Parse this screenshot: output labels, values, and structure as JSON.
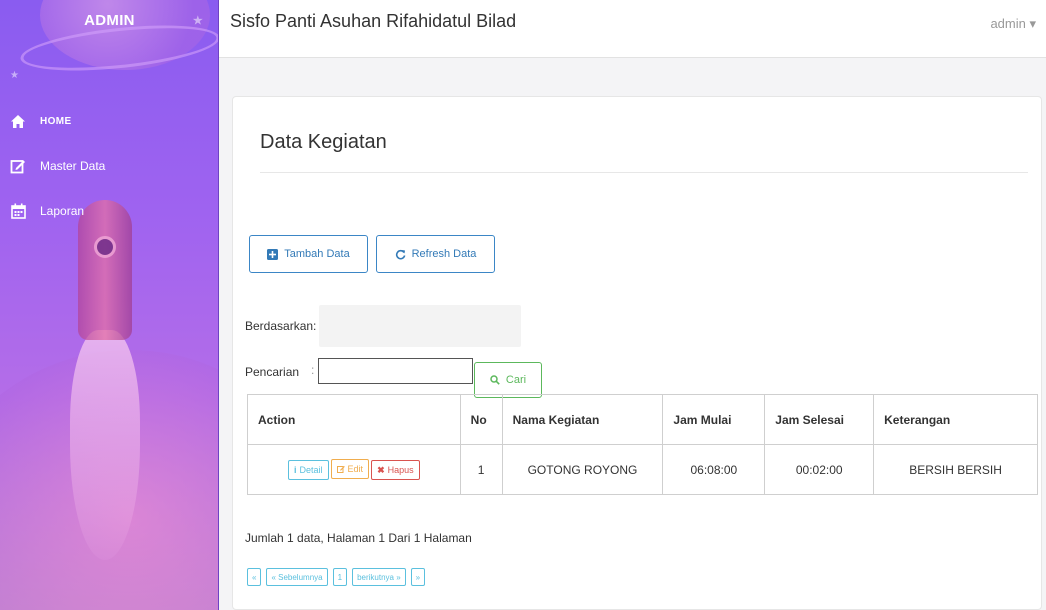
{
  "sidebar": {
    "brand": "ADMIN",
    "items": [
      {
        "label": "HOME",
        "icon": "home-icon"
      },
      {
        "label": "Master Data",
        "icon": "edit-icon"
      },
      {
        "label": "Laporan",
        "icon": "calendar-icon"
      }
    ]
  },
  "header": {
    "title": "Sisfo Panti Asuhan Rifahidatul Bilad",
    "user": "admin ▾"
  },
  "main": {
    "page_title": "Data Kegiatan",
    "buttons": {
      "add": "Tambah Data",
      "refresh": "Refresh Data",
      "search": "Cari"
    },
    "filter": {
      "by_label": "Berdasarkan:",
      "search_label": "Pencarian",
      "colon": ":",
      "search_value": ""
    },
    "table": {
      "columns": [
        "Action",
        "No",
        "Nama Kegiatan",
        "Jam Mulai",
        "Jam Selesai",
        "Keterangan"
      ],
      "rows": [
        {
          "no": "1",
          "nama": "GOTONG ROYONG",
          "mulai": "06:08:00",
          "selesai": "00:02:00",
          "ket": "BERSIH BERSIH"
        }
      ],
      "row_actions": {
        "detail": "Detail",
        "edit": "Edit",
        "hapus": "Hapus"
      }
    },
    "summary": "Jumlah 1 data, Halaman 1 Dari 1 Halaman",
    "pagination": {
      "first": "«",
      "prev": "« Sebelumnya",
      "page": "1",
      "next": "berikutnya »",
      "last": "»"
    }
  },
  "colors": {
    "sidebar_top": "#8a5cf0",
    "primary": "#337ab7",
    "success": "#5cb85c",
    "info": "#5bc0de",
    "warning": "#f0ad4e",
    "danger": "#d9534f"
  }
}
